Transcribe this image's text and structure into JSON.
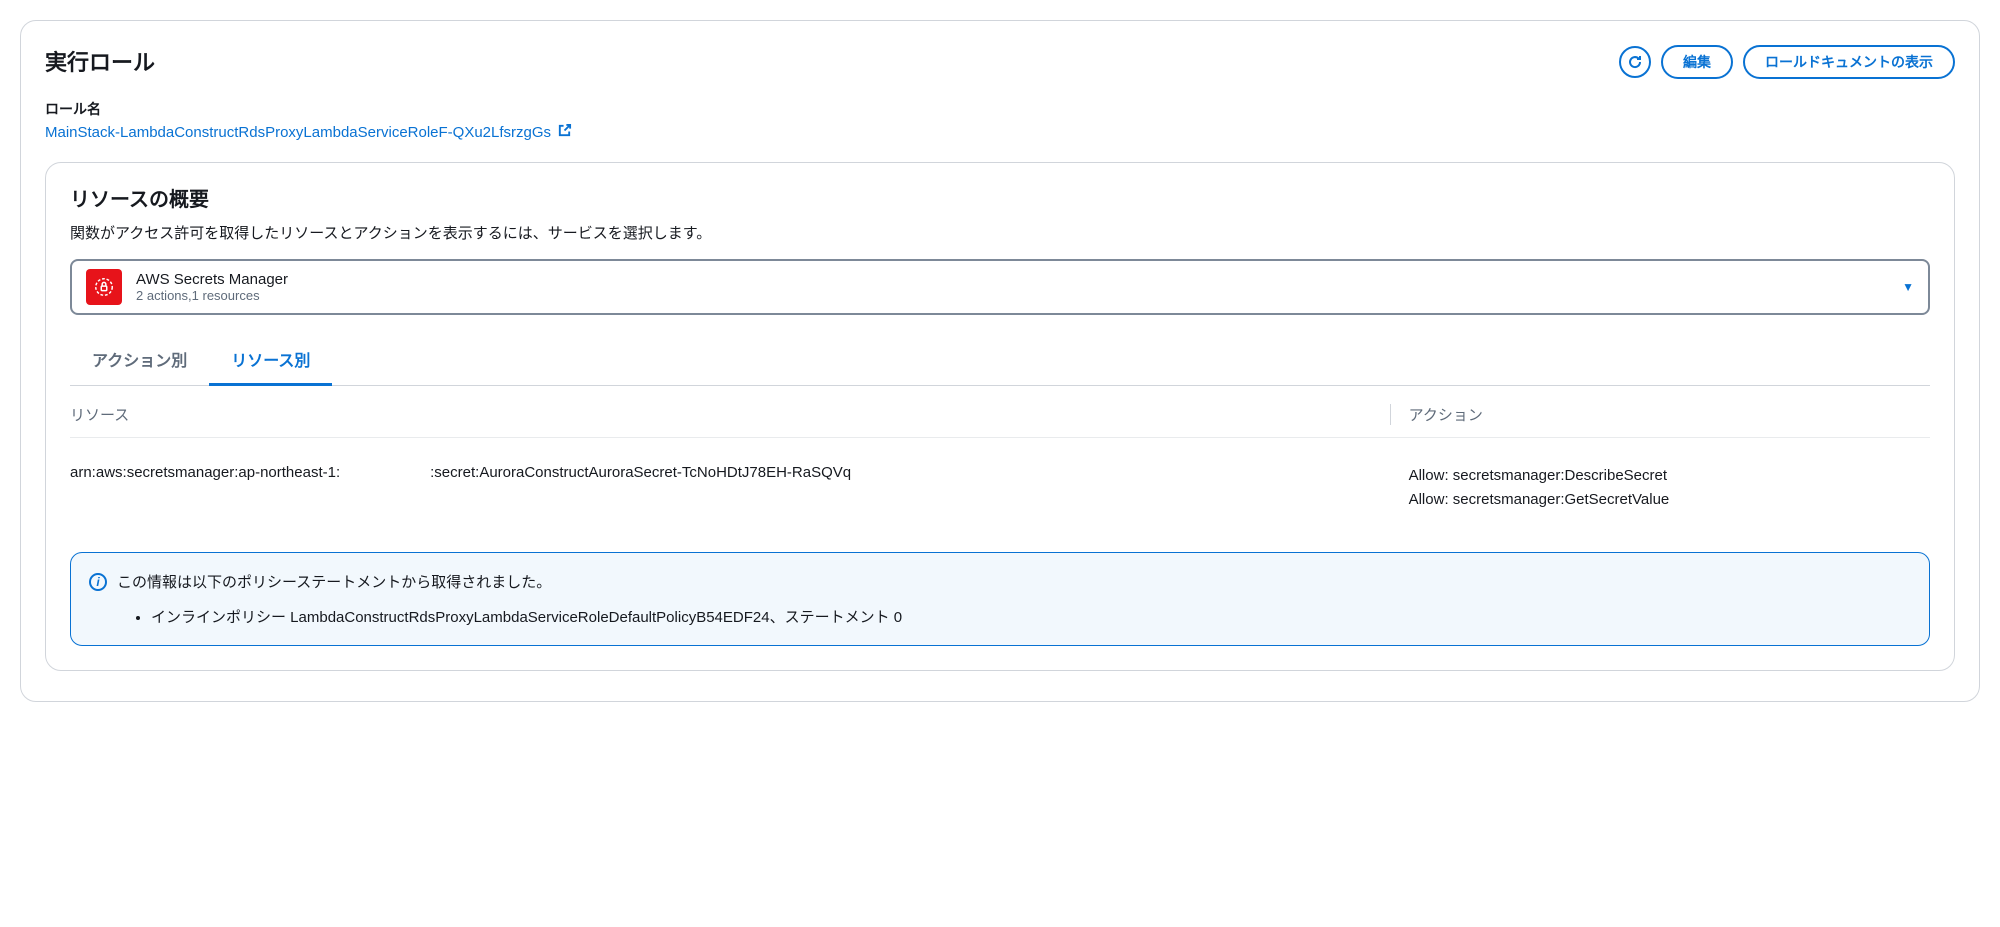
{
  "header": {
    "title": "実行ロール",
    "refresh_label": "Refresh",
    "edit_label": "編集",
    "view_doc_label": "ロールドキュメントの表示"
  },
  "role": {
    "label": "ロール名",
    "name": "MainStack-LambdaConstructRdsProxyLambdaServiceRoleF-QXu2LfsrzgGs"
  },
  "summary": {
    "title": "リソースの概要",
    "description": "関数がアクセス許可を取得したリソースとアクションを表示するには、サービスを選択します。"
  },
  "service_select": {
    "name": "AWS Secrets Manager",
    "meta": "2 actions,1 resources"
  },
  "tabs": {
    "by_action": "アクション別",
    "by_resource": "リソース別"
  },
  "table": {
    "col_resource": "リソース",
    "col_action": "アクション",
    "rows": [
      {
        "resource_prefix": "arn:aws:secretsmanager:ap-northeast-1:",
        "resource_suffix": ":secret:AuroraConstructAuroraSecret-TcNoHDtJ78EH-RaSQVq",
        "actions": [
          "Allow: secretsmanager:DescribeSecret",
          "Allow: secretsmanager:GetSecretValue"
        ]
      }
    ]
  },
  "info": {
    "heading": "この情報は以下のポリシーステートメントから取得されました。",
    "item": "インラインポリシー LambdaConstructRdsProxyLambdaServiceRoleDefaultPolicyB54EDF24、ステートメント 0"
  }
}
